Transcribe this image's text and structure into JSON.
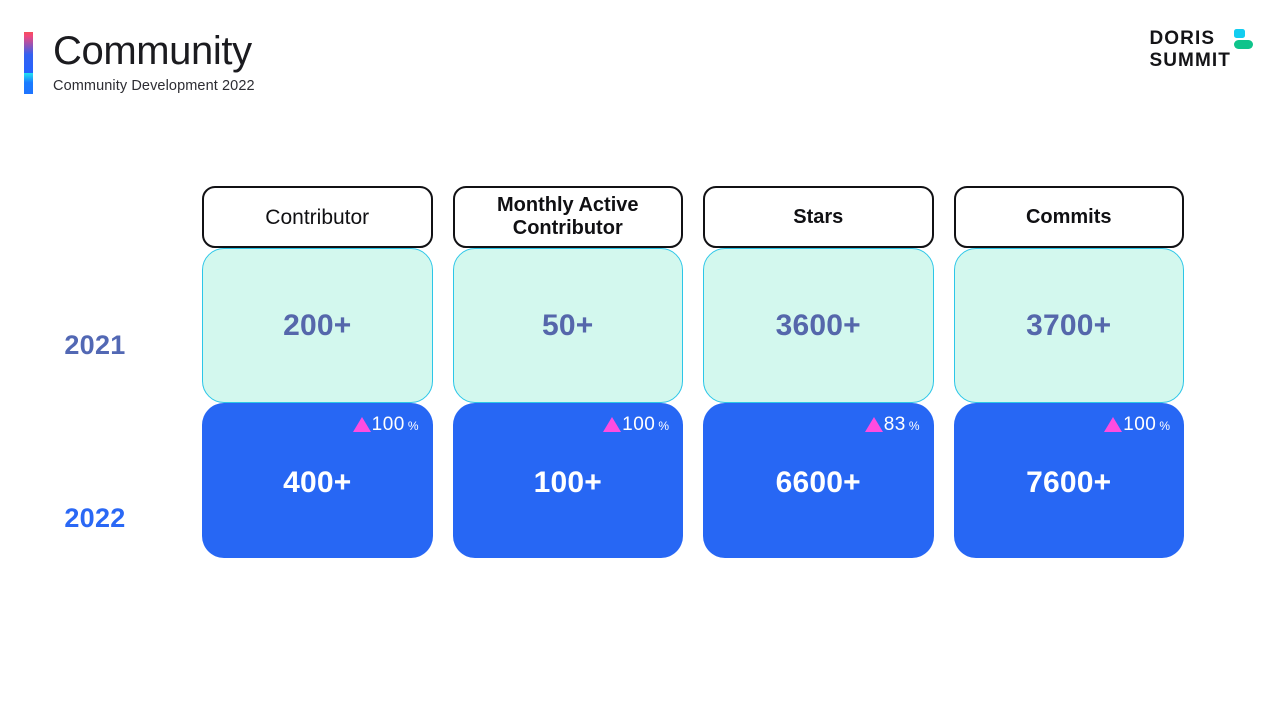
{
  "header": {
    "title": "Community",
    "subtitle": "Community Development 2022"
  },
  "logo": {
    "line1": "DORIS",
    "line2": "SUMMIT",
    "mark_square_color": "#12cdf0",
    "mark_bar_color": "#0fc48b"
  },
  "colors": {
    "card_2021_bg": "#d3f8ee",
    "card_2021_border": "#2bc6e8",
    "card_2021_text": "#5567ab",
    "card_2022_bg": "#2767f4",
    "card_2022_text": "#ffffff",
    "badge_triangle": "#ff4ce0",
    "year_2021": "#5268b4",
    "year_2022": "#2a68f5",
    "head_border": "#111114"
  },
  "rows": {
    "year_2021_label": "2021",
    "year_2022_label": "2022"
  },
  "metrics": [
    {
      "header": "Contributor",
      "header_style": "regular",
      "value_2021": "200+",
      "value_2022": "400+",
      "change_value": "100",
      "change_unit": "%",
      "change_direction": "up"
    },
    {
      "header": "Monthly Active Contributor",
      "header_style": "bold",
      "value_2021": "50+",
      "value_2022": "100+",
      "change_value": "100",
      "change_unit": "%",
      "change_direction": "up"
    },
    {
      "header": "Stars",
      "header_style": "bold",
      "value_2021": "3600+",
      "value_2022": "6600+",
      "change_value": "83",
      "change_unit": "%",
      "change_direction": "up"
    },
    {
      "header": "Commits",
      "header_style": "bold",
      "value_2021": "3700+",
      "value_2022": "7600+",
      "change_value": "100",
      "change_unit": "%",
      "change_direction": "up"
    }
  ],
  "chart_data": {
    "type": "table",
    "title": "Community Development 2022",
    "categories": [
      "Contributor",
      "Monthly Active Contributor",
      "Stars",
      "Commits"
    ],
    "series": [
      {
        "name": "2021",
        "values": [
          200,
          50,
          3600,
          3700
        ]
      },
      {
        "name": "2022",
        "values": [
          400,
          100,
          6600,
          7600
        ]
      }
    ],
    "growth_percent": [
      100,
      100,
      83,
      100
    ],
    "xlabel": "",
    "ylabel": "",
    "legend": [
      "2021",
      "2022"
    ]
  }
}
